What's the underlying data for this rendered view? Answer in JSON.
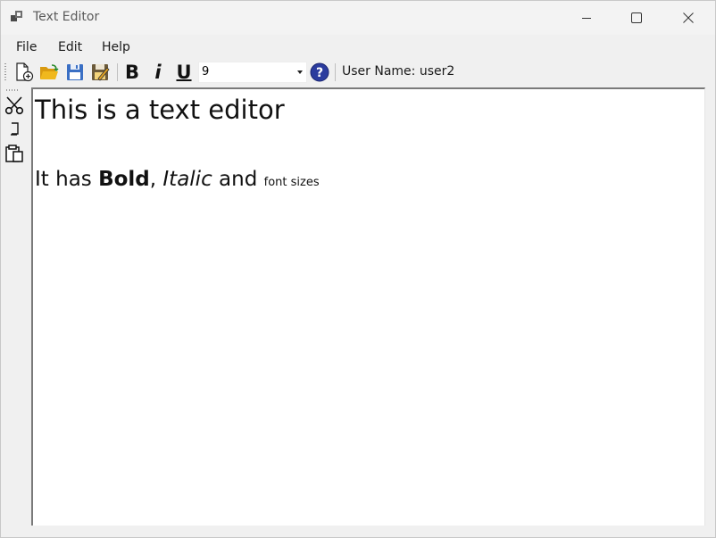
{
  "window": {
    "title": "Text Editor"
  },
  "icons": {
    "app": "app-icon",
    "minimize": "minimize-icon",
    "maximize": "maximize-icon",
    "close": "close-icon",
    "new_file": "new-file-icon",
    "open_folder": "open-folder-icon",
    "save": "save-icon",
    "save_as": "save-as-icon",
    "help": "help-icon",
    "cut": "scissors-icon",
    "copy": "copy-icon",
    "paste": "paste-icon"
  },
  "menu": [
    "File",
    "Edit",
    "Help"
  ],
  "toolbar": {
    "bold": "B",
    "italic": "i",
    "underline": "U",
    "font_size": "9",
    "user_label": "User Name: user2"
  },
  "editor": {
    "line1": "This is a text editor",
    "line2": {
      "prefix": "It has ",
      "bold": "Bold",
      "comma": ", ",
      "italic": "Italic",
      "and": " and ",
      "small": "font sizes"
    }
  },
  "colors": {
    "help_blue": "#2b3c9e",
    "save_blue": "#3a6fc4",
    "folder_yellow": "#f0b81e"
  }
}
